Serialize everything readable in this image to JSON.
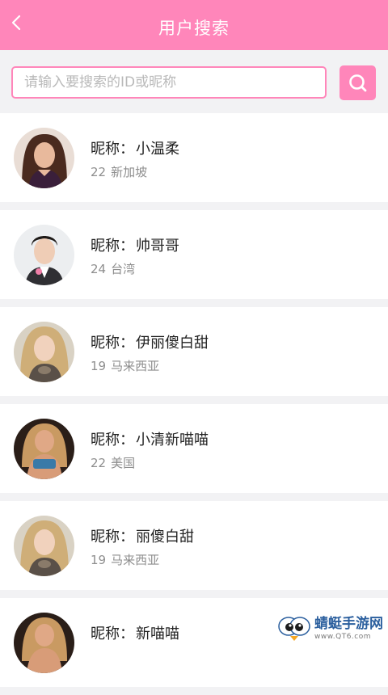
{
  "header": {
    "title": "用户搜索",
    "back_icon": "chevron-left-icon"
  },
  "search": {
    "placeholder": "请输入要搜索的ID或昵称",
    "value": "",
    "button_icon": "search-icon"
  },
  "labels": {
    "nickname_prefix": "昵称："
  },
  "users": [
    {
      "nickname": "小温柔",
      "age": "22",
      "location": "新加坡"
    },
    {
      "nickname": "帅哥哥",
      "age": "24",
      "location": "台湾"
    },
    {
      "nickname": "伊丽傻白甜",
      "age": "19",
      "location": "马来西亚"
    },
    {
      "nickname": "小清新喵喵",
      "age": "22",
      "location": "美国"
    },
    {
      "nickname": "丽傻白甜",
      "age": "19",
      "location": "马来西亚"
    },
    {
      "nickname": "新喵喵",
      "age": "",
      "location": ""
    }
  ],
  "watermark": {
    "name": "蜻蜓手游网",
    "url": "www.QT6.com"
  },
  "colors": {
    "accent": "#ff86ba",
    "background": "#f2f2f4"
  }
}
